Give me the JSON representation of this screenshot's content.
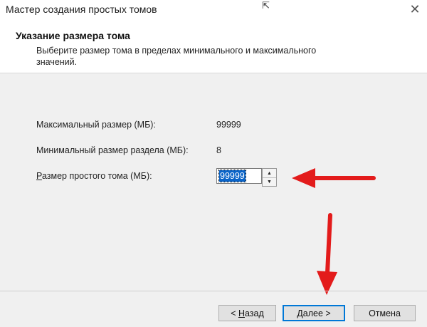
{
  "window": {
    "title": "Мастер создания простых томов",
    "close_glyph": "✕",
    "resize_glyph": "⇱"
  },
  "header": {
    "title": "Указание размера тома",
    "description": "Выберите размер тома в пределах минимального и максимального значений."
  },
  "fields": {
    "max_label": "Максимальный размер (МБ):",
    "max_value": "99999",
    "min_label": "Минимальный размер раздела (МБ):",
    "min_value": "8",
    "size_label_accel": "Р",
    "size_label_rest": "азмер простого тома (МБ):",
    "size_value": "99999"
  },
  "spinner": {
    "up_glyph": "▲",
    "down_glyph": "▼"
  },
  "buttons": {
    "back_prefix": "< ",
    "back_accel": "Н",
    "back_rest": "азад",
    "next_accel": "Д",
    "next_rest": "алее >",
    "cancel": "Отмена"
  },
  "annotations": {
    "arrow_color": "#e31b1b"
  }
}
